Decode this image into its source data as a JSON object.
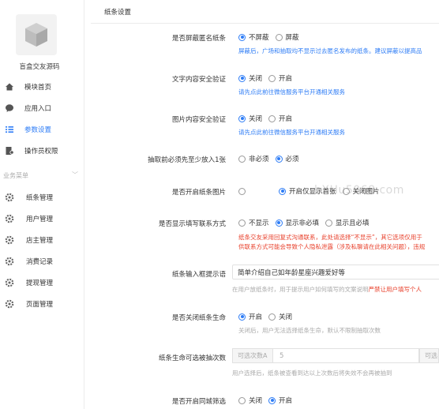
{
  "sidebar": {
    "app_name": "盲盒交友源码",
    "nav": [
      {
        "label": "模块首页",
        "icon": "home-icon"
      },
      {
        "label": "应用入口",
        "icon": "chat-bubble-icon"
      },
      {
        "label": "参数设置",
        "icon": "list-settings-icon",
        "active": true
      },
      {
        "label": "操作员权限",
        "icon": "document-user-icon"
      }
    ],
    "section_label": "业务菜单",
    "sub_items": [
      {
        "label": "纸条管理",
        "icon": "gear-icon"
      },
      {
        "label": "用户管理",
        "icon": "gear-icon"
      },
      {
        "label": "店主管理",
        "icon": "gear-icon"
      },
      {
        "label": "消费记录",
        "icon": "gear-icon"
      },
      {
        "label": "提现管理",
        "icon": "gear-icon"
      },
      {
        "label": "页面管理",
        "icon": "gear-icon"
      }
    ]
  },
  "main": {
    "header": "纸条设置",
    "watermark": "bXHu5068.com",
    "fields": {
      "anon": {
        "label": "是否屏蔽匿名纸条",
        "options": [
          "不屏蔽",
          "屏蔽"
        ],
        "selected": 0,
        "hint": "屏蔽后，广场和抽取均不显示过去匿名发布的纸条。建议屏蔽以提高品"
      },
      "text_check": {
        "label": "文字内容安全验证",
        "options": [
          "关闭",
          "开启"
        ],
        "selected": 0,
        "hint": "请先点此前往微信服务平台开通相关服务"
      },
      "img_check": {
        "label": "图片内容安全验证",
        "options": [
          "关闭",
          "开启"
        ],
        "selected": 0,
        "hint": "请先点此前往微信服务平台开通相关服务"
      },
      "must_put": {
        "label": "抽取前必须先至少放入1张",
        "options": [
          "非必须",
          "必须"
        ],
        "selected": 1
      },
      "show_img": {
        "label": "是否开启纸条图片",
        "options": [
          "",
          "开启仅显示首张",
          "关闭图片"
        ],
        "selected": 1
      },
      "contact": {
        "label": "是否显示填写联系方式",
        "options": [
          "不显示",
          "显示非必填",
          "显示且必填"
        ],
        "selected": 1,
        "hint1": "纸条交友采用回复式沟通联系，此处请选择“不显示”，其它选项仅用于",
        "hint2": "供联系方式可能会导致个人隐私泄露（涉及私聊请在此相关问题），违规"
      },
      "placeholder": {
        "label": "纸条输入框提示语",
        "value": "简单介绍自己如年龄星座兴趣爱好等",
        "hint_prefix": "在用户放纸条时，用于提示用户如何填写的文案说明",
        "hint_red": "严禁让用户填写个人"
      },
      "lifetime": {
        "label": "是否关闭纸条生命",
        "options": [
          "开启",
          "关闭"
        ],
        "selected": 0,
        "hint": "关闭后，用户无法选择纸条生命，默认不限制抽取次数"
      },
      "times": {
        "label": "纸条生命可选被抽次数",
        "addon_left": "可选次数A",
        "value": "5",
        "addon_right": "可选",
        "hint": "用户选择后，纸条被查看到达以上次数后将失效不会再被抽到"
      },
      "city": {
        "label": "是否开启同城筛选",
        "options": [
          "关闭",
          "开启"
        ],
        "selected": 1
      }
    }
  }
}
